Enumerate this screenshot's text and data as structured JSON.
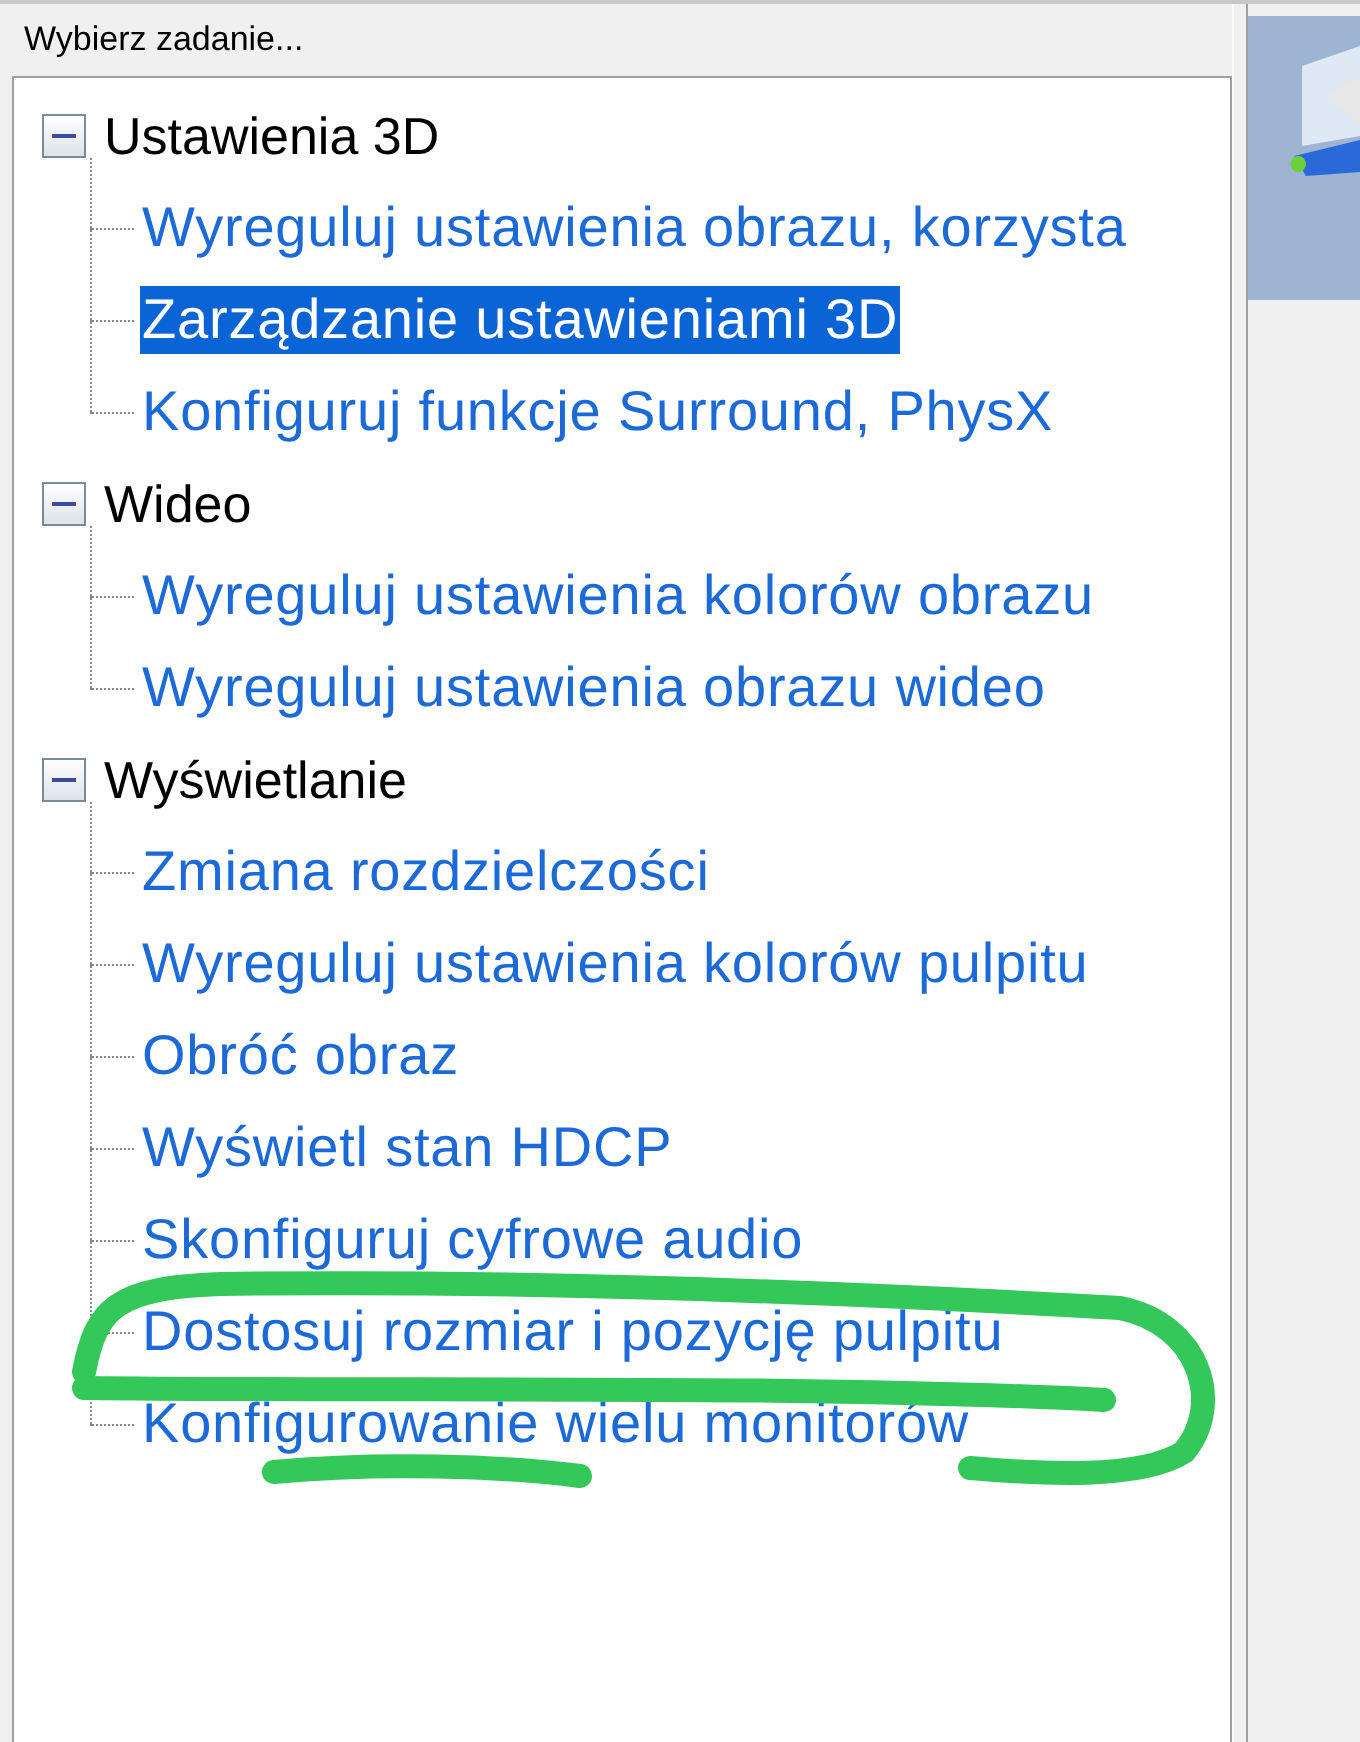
{
  "header": "Wybierz zadanie...",
  "tree": [
    {
      "label": "Ustawienia 3D",
      "expanded": true,
      "children": [
        {
          "label": "Wyreguluj ustawienia obrazu, korzysta",
          "selected": false
        },
        {
          "label": "Zarządzanie ustawieniami 3D",
          "selected": true
        },
        {
          "label": "Konfiguruj funkcje Surround, PhysX",
          "selected": false
        }
      ]
    },
    {
      "label": "Wideo",
      "expanded": true,
      "children": [
        {
          "label": "Wyreguluj ustawienia kolorów obrazu",
          "selected": false
        },
        {
          "label": "Wyreguluj ustawienia obrazu wideo",
          "selected": false
        }
      ]
    },
    {
      "label": "Wyświetlanie",
      "expanded": true,
      "children": [
        {
          "label": "Zmiana rozdzielczości",
          "selected": false
        },
        {
          "label": "Wyreguluj ustawienia kolorów pulpitu",
          "selected": false
        },
        {
          "label": "Obróć obraz",
          "selected": false
        },
        {
          "label": "Wyświetl stan HDCP",
          "selected": false
        },
        {
          "label": "Skonfiguruj cyfrowe audio",
          "selected": false
        },
        {
          "label": "Dostosuj rozmiar i pozycję pulpitu",
          "selected": false
        },
        {
          "label": "Konfigurowanie wielu monitorów",
          "selected": false
        }
      ]
    }
  ]
}
